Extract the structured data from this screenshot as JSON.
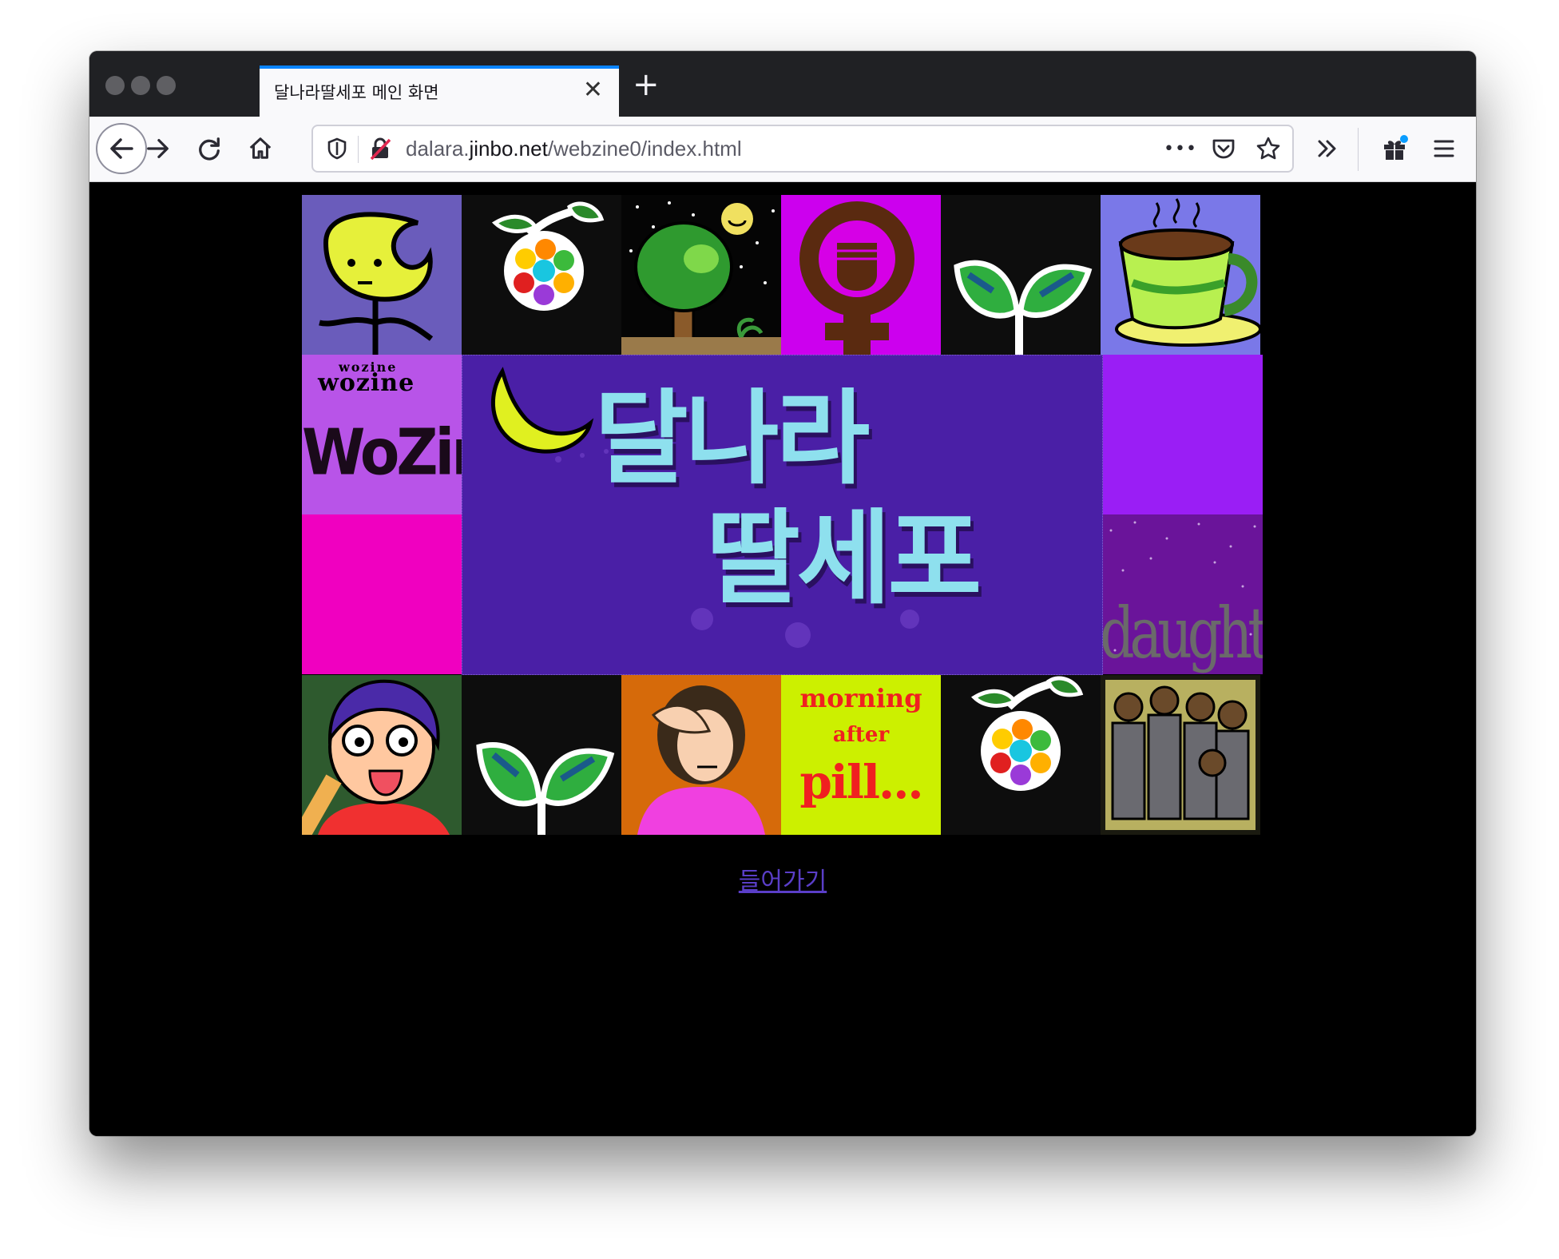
{
  "browser": {
    "tab_title": "달나라딸세포 메인 화면",
    "url_host_pre": "dalara.",
    "url_host": "jinbo.net",
    "url_path": "/webzine0/index.html"
  },
  "page": {
    "banner_title_line1": "달나라",
    "banner_title_line2": "딸세포",
    "tiles": {
      "wozine_small": "wozine",
      "wozine_large": "WoZine",
      "daughter": "daughter",
      "morning": "morning",
      "after": "after",
      "pill": "pill..."
    },
    "enter_link": "들어가기"
  },
  "colors": {
    "banner_bg": "#4a1fa6",
    "link": "#5a3ec8",
    "tab_accent": "#0a84ff"
  },
  "icons": [
    "back-arrow-icon",
    "forward-arrow-icon",
    "reload-icon",
    "home-icon",
    "shield-icon",
    "insecure-lock-icon",
    "more-icon",
    "pocket-icon",
    "star-icon",
    "overflow-chevron-icon",
    "gift-icon",
    "menu-icon",
    "close-icon",
    "plus-icon"
  ]
}
